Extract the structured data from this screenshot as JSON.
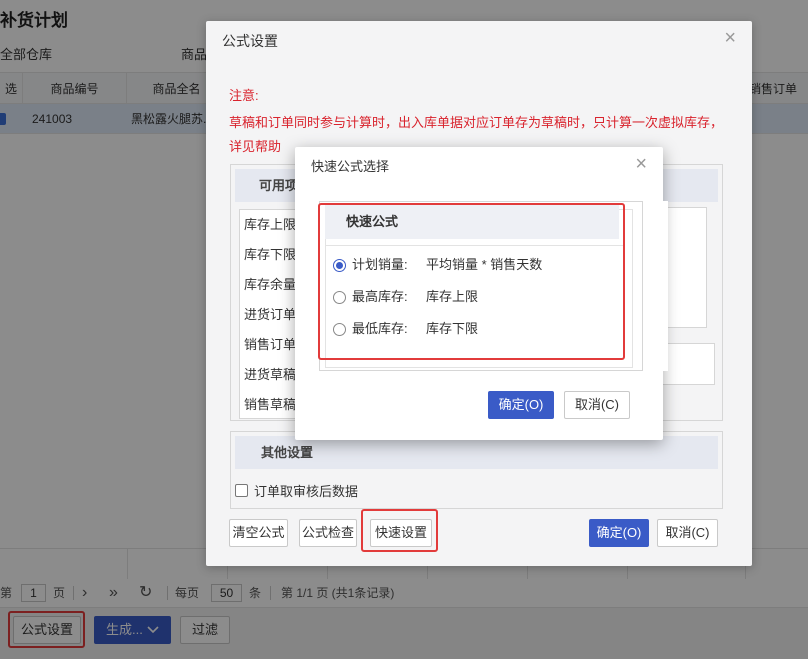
{
  "page": {
    "title": "补货计划",
    "filter_warehouse": "全部仓库",
    "filter_product": "商品"
  },
  "grid": {
    "columns": [
      "选择",
      "商品编号",
      "商品全名",
      "销售订单量"
    ],
    "rows": [
      {
        "code": "241003",
        "name": "黑松露火腿苏..."
      }
    ]
  },
  "pager": {
    "page_prefix": "第",
    "page_value": "1",
    "page_suffix": "页",
    "next": "›",
    "last": "»",
    "refresh": "↻",
    "per_page_prefix": "每页",
    "per_page_value": "50",
    "per_page_suffix": "条",
    "summary": "第 1/1 页 (共1条记录)"
  },
  "bottom_toolbar": {
    "formula_button": "公式设置",
    "generate_button": "生成...",
    "filter_button": "过滤"
  },
  "formula_dialog": {
    "title": "公式设置",
    "notice_title": "注意:",
    "notice_text": "草稿和订单同时参与计算时，出入库单据对应订单存为草稿时，只计算一次虚拟库存，详见帮助",
    "available_header": "可用项",
    "available_items": [
      "库存上限",
      "库存下限",
      "库存余量",
      "进货订单",
      "销售订单",
      "进货草稿",
      "销售草稿"
    ],
    "other_header": "其他设置",
    "other_checkbox": "订单取审核后数据",
    "btn_clear": "清空公式",
    "btn_check": "公式检查",
    "btn_quick": "快速设置",
    "btn_ok": "确定(O)",
    "btn_cancel": "取消(C)"
  },
  "quick_dialog": {
    "title": "快速公式选择",
    "header": "快速公式",
    "options": [
      {
        "label": "计划销量:",
        "value": "平均销量 * 销售天数",
        "selected": true
      },
      {
        "label": "最高库存:",
        "value": "库存上限",
        "selected": false
      },
      {
        "label": "最低库存:",
        "value": "库存下限",
        "selected": false
      }
    ],
    "btn_ok": "确定(O)",
    "btn_cancel": "取消(C)"
  },
  "colors": {
    "primary": "#3a5bc7",
    "highlight": "#e23b3b",
    "notice": "#d9232d"
  }
}
